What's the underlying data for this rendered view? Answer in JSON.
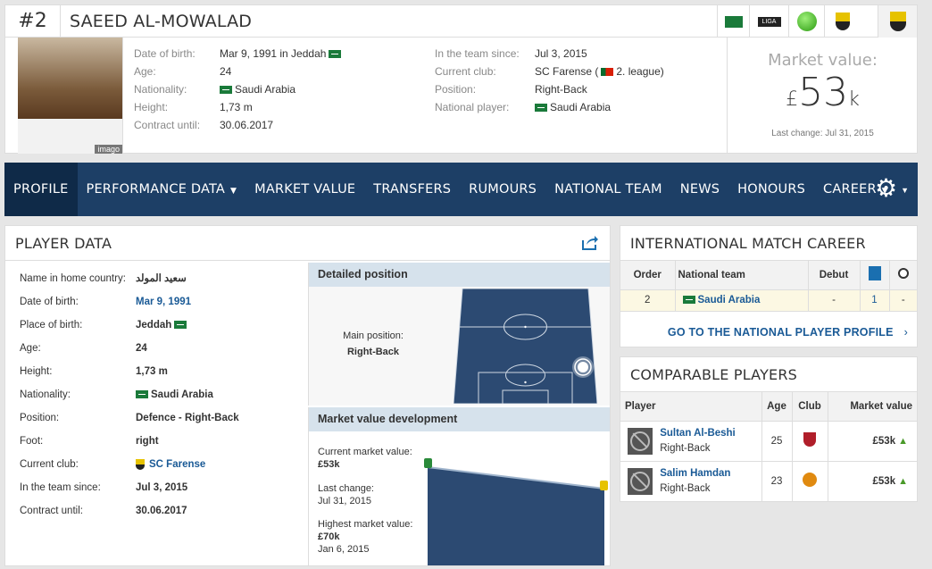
{
  "header": {
    "shirt_number": "#2",
    "name": "SAEED AL-MOWALAD",
    "left_info": [
      {
        "label": "Date of birth:",
        "value": "Mar 9, 1991 in Jeddah",
        "flag": true
      },
      {
        "label": "Age:",
        "value": "24"
      },
      {
        "label": "Nationality:",
        "value": "Saudi Arabia",
        "flag_before": true
      },
      {
        "label": "Height:",
        "value": "1,73 m"
      },
      {
        "label": "Contract until:",
        "value": "30.06.2017"
      }
    ],
    "right_info": [
      {
        "label": "In the team since:",
        "value": "Jul 3, 2015"
      },
      {
        "label": "Current club:",
        "value": "SC Farense",
        "extra": "2. league"
      },
      {
        "label": "Position:",
        "value": "Right-Back"
      },
      {
        "label": "National player:",
        "value": "Saudi Arabia"
      }
    ],
    "photo_credit": "imago",
    "market_value": {
      "label": "Market value:",
      "currency": "£",
      "amount": "53",
      "suffix": "k",
      "last_change": "Last change: Jul 31, 2015"
    },
    "icons": [
      "saudi-flag-icon",
      "liga-logo-icon",
      "green-status-icon",
      "club-crest-icon",
      "club-crest-active-icon"
    ],
    "league_badge_text": "LIGA"
  },
  "nav": {
    "items": [
      {
        "label": "PROFILE",
        "active": true
      },
      {
        "label": "PERFORMANCE DATA",
        "dropdown": true
      },
      {
        "label": "MARKET VALUE"
      },
      {
        "label": "TRANSFERS"
      },
      {
        "label": "RUMOURS"
      },
      {
        "label": "NATIONAL TEAM"
      },
      {
        "label": "NEWS"
      },
      {
        "label": "HONOURS"
      },
      {
        "label": "CAREER",
        "dropdown": true
      }
    ],
    "settings_icon": "gear-icon"
  },
  "player_data": {
    "title": "PLAYER DATA",
    "rows": [
      {
        "label": "Name in home country:",
        "value": "سعيد المولد"
      },
      {
        "label": "Date of birth:",
        "value": "Mar 9, 1991",
        "link": true
      },
      {
        "label": "Place of birth:",
        "value": "Jeddah"
      },
      {
        "label": "Age:",
        "value": "24"
      },
      {
        "label": "Height:",
        "value": "1,73 m"
      },
      {
        "label": "Nationality:",
        "value": "Saudi Arabia"
      },
      {
        "label": "Position:",
        "value": "Defence - Right-Back"
      },
      {
        "label": "Foot:",
        "value": "right"
      },
      {
        "label": "Current club:",
        "value": "SC Farense",
        "link": true
      },
      {
        "label": "In the team since:",
        "value": "Jul 3, 2015"
      },
      {
        "label": "Contract until:",
        "value": "30.06.2017"
      }
    ],
    "detailed_position": {
      "title": "Detailed position",
      "main_label": "Main position:",
      "main_value": "Right-Back"
    },
    "mv_development": {
      "title": "Market value development",
      "current_label": "Current market value:",
      "current_value": "£53k",
      "last_change_label": "Last change:",
      "last_change_value": "Jul 31, 2015",
      "highest_label": "Highest market value:",
      "highest_value": "£70k",
      "highest_date": "Jan 6, 2015"
    }
  },
  "international": {
    "title": "INTERNATIONAL MATCH CAREER",
    "headers": [
      "Order",
      "National team",
      "Debut"
    ],
    "header_icons": [
      "appearances-icon",
      "goals-icon"
    ],
    "rows": [
      {
        "order": "2",
        "team": "Saudi Arabia",
        "debut": "-",
        "apps": "1",
        "goals": "-"
      }
    ],
    "link": "GO TO THE NATIONAL PLAYER PROFILE"
  },
  "comparable": {
    "title": "COMPARABLE PLAYERS",
    "headers": [
      "Player",
      "Age",
      "Club",
      "Market value"
    ],
    "rows": [
      {
        "name": "Sultan Al-Beshi",
        "position": "Right-Back",
        "age": "25",
        "value": "£53k"
      },
      {
        "name": "Salim Hamdan",
        "position": "Right-Back",
        "age": "23",
        "value": "£53k"
      }
    ]
  },
  "colors": {
    "nav_bg": "#1d3f66",
    "nav_active": "#0f2a48",
    "link": "#1a5a96",
    "subheader_bg": "#d6e2ec",
    "pitch": "#2c4a72",
    "up_arrow": "#4a9a2a"
  }
}
